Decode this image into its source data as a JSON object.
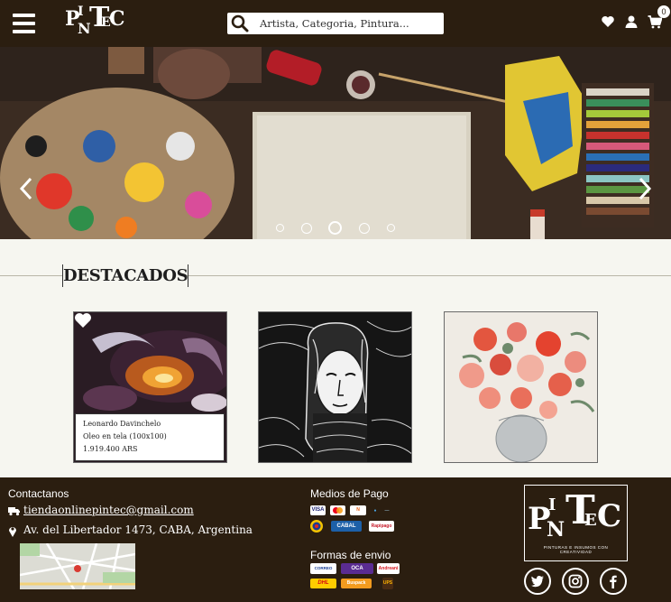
{
  "header": {
    "logo_text": "PINTEC",
    "search_placeholder": "Artista, Categoria, Pintura...",
    "cart_count": "0"
  },
  "hero": {
    "slide_count": 5,
    "active_slide": 3
  },
  "featured": {
    "title": "DESTACADOS",
    "cards": [
      {
        "artist": "Leonardo Davinchelo",
        "technique": "Oleo en tela (100x100)",
        "price": "1.919.400 ARS"
      }
    ]
  },
  "footer": {
    "contact_heading": "Contactanos",
    "email": "tiendaonlinepintec@gmail.com",
    "address": "Av. del Libertador 1473, CABA, Argentina",
    "payment_heading": "Medios de Pago",
    "shipping_heading": "Formas de envio",
    "payment_methods": [
      "VISA",
      "Mastercard",
      "Naranja",
      "Mercado Pago",
      "Diners",
      "Pago Fácil",
      "CABAL",
      "Rapipago"
    ],
    "shipping_methods": [
      "Correo Argentino",
      "OCA",
      "Andreani",
      "DHL",
      "Buspack",
      "UPS"
    ],
    "logo_tagline": "PINTURAS E INSUMOS CON CREATIVIDAD"
  },
  "colors": {
    "brand_dark": "#2b1e10",
    "page_bg": "#f6f6f0"
  }
}
